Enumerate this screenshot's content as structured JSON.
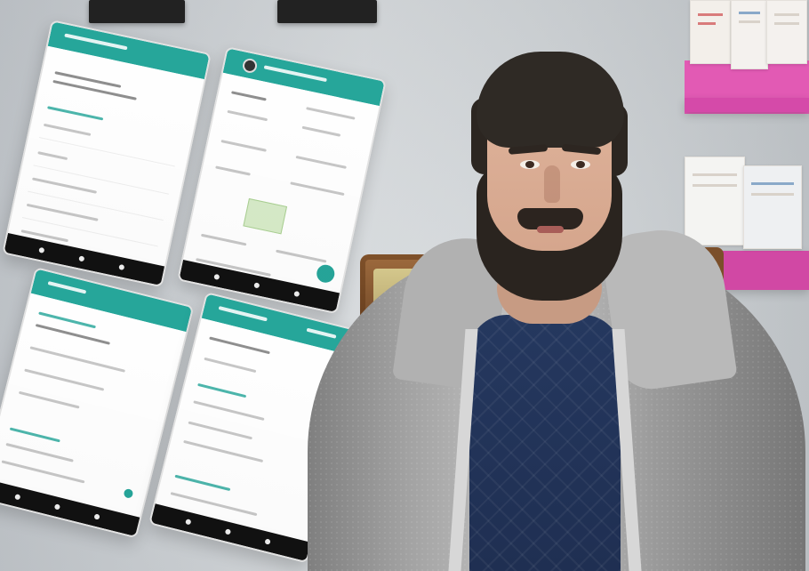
{
  "scene": {
    "subject": "",
    "colors": {
      "wall": "#d7dbde",
      "shelf": "#d54aa9",
      "accent": "#26a69a",
      "jacket": "#a2a2a2",
      "shirt": "#25385f",
      "beard": "#2a241f"
    }
  }
}
